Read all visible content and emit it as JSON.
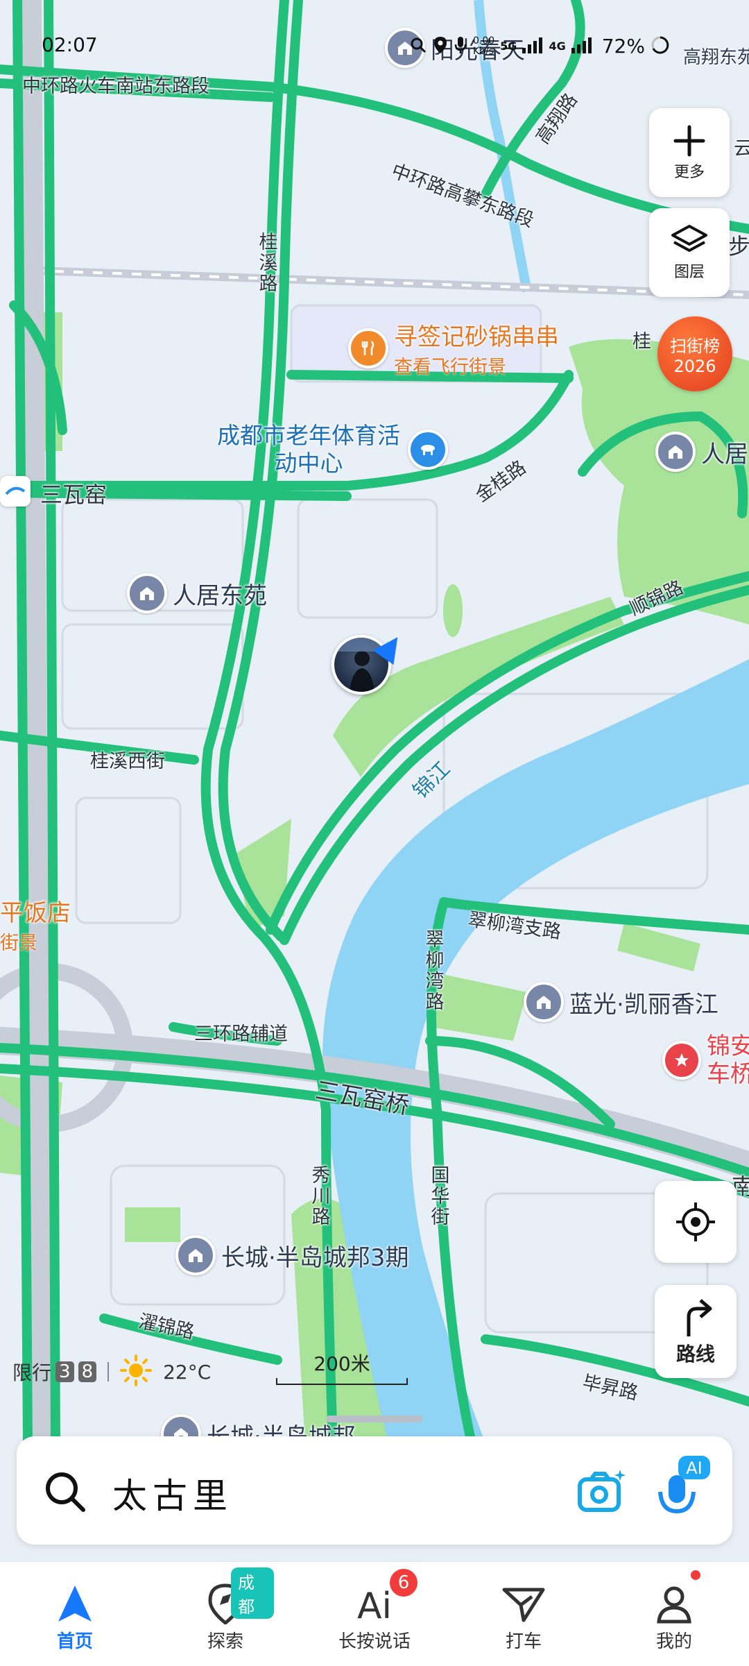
{
  "status_bar": {
    "time": "02:07",
    "net_speed_top": "0.00",
    "net_speed_unit": "Kb/s",
    "sim1_type": "5G",
    "sim2_type": "4G",
    "battery": "72%"
  },
  "map": {
    "road_labels": [
      "中环路火车南站东路段",
      "中环路高攀东路段",
      "高翔路",
      "桂溪路",
      "三瓦窑",
      "金桂路",
      "顺锦路",
      "桂溪西街",
      "锦江",
      "翠柳湾支路",
      "翠柳湾路",
      "三环路辅道",
      "三瓦窑桥",
      "秀川路",
      "国华街",
      "濯锦路",
      "毕昇路",
      "桂",
      "步",
      "云",
      "南"
    ],
    "pois": [
      {
        "name": "阳光春天",
        "type": "residential"
      },
      {
        "name": "高翔东苑",
        "type": "residential"
      },
      {
        "name": "成都市老年体育活动中心",
        "type": "sports"
      },
      {
        "name": "人居东苑",
        "type": "residential"
      },
      {
        "name": "人居",
        "type": "residential"
      },
      {
        "name": "蓝光·凯丽香江",
        "type": "residential"
      },
      {
        "name": "长城·半岛城邦3期",
        "type": "residential"
      },
      {
        "name": "长城·半岛城邦",
        "type": "residential"
      }
    ],
    "food_poi": {
      "name": "寻签记砂锅串串",
      "sub": "查看飞行街景"
    },
    "food_poi_left": {
      "name": "平饭店",
      "sub": "街景"
    },
    "red_poi": {
      "name_line1": "锦安",
      "name_line2": "车桥"
    },
    "scan_badge": {
      "line1": "扫街榜",
      "line2": "2026"
    },
    "restriction": {
      "label": "限行",
      "numbers": [
        "3",
        "8"
      ]
    },
    "weather": {
      "temp": "22°C"
    },
    "scale": "200米"
  },
  "side_controls": {
    "more_label": "更多",
    "layers_label": "图层",
    "route_label": "路线"
  },
  "search": {
    "placeholder": "太古里"
  },
  "nav": {
    "home": "首页",
    "explore": "探索",
    "explore_badge": "成都",
    "ai": "长按说话",
    "ai_badge": "6",
    "taxi": "打车",
    "mine": "我的"
  },
  "colors": {
    "road_green": "#22c07a",
    "river": "#8fd3f5",
    "park": "#a9e39a",
    "accent_blue": "#1677ff",
    "poi_orange": "#e5781f"
  }
}
